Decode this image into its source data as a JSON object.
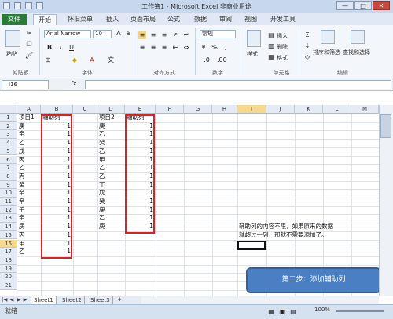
{
  "window": {
    "title": "工作簿1 - Microsoft Excel 非商业用途",
    "controls": [
      "—",
      "□",
      "✕"
    ]
  },
  "ribbon": {
    "tabs": [
      "文件",
      "开始",
      "插入",
      "页面布局",
      "公式",
      "数据",
      "审阅",
      "视图",
      "开发工具"
    ],
    "font_name": "Arial Narrow",
    "font_size": "10",
    "number_format": "常规",
    "paste_label": "粘贴",
    "style_label": "样式",
    "insert_label": "插入",
    "delete_label": "删除",
    "format_label": "格式",
    "sort_label": "排序和筛选",
    "find_label": "查找和选择",
    "groups": [
      "剪贴板",
      "字体",
      "对齐方式",
      "数字",
      "单元格",
      "编辑"
    ]
  },
  "formula_bar": {
    "name_box": "I16",
    "fx": "fx",
    "value": ""
  },
  "grid": {
    "columns": [
      "A",
      "B",
      "C",
      "D",
      "E",
      "F",
      "G",
      "H",
      "I",
      "J",
      "K",
      "L",
      "M"
    ],
    "rows": [
      "1",
      "2",
      "3",
      "4",
      "5",
      "6",
      "7",
      "8",
      "9",
      "10",
      "11",
      "12",
      "13",
      "14",
      "15",
      "16",
      "17",
      "18",
      "19",
      "20",
      "21",
      "22",
      "23"
    ],
    "colA": [
      "项目1",
      "庚",
      "辛",
      "乙",
      "戊",
      "丙",
      "乙",
      "丙",
      "癸",
      "辛",
      "辛",
      "壬",
      "辛",
      "庚",
      "丙",
      "甲",
      "乙"
    ],
    "colB": [
      "辅助列",
      "1",
      "1",
      "1",
      "1",
      "1",
      "1",
      "1",
      "1",
      "1",
      "1",
      "1",
      "1",
      "1",
      "1",
      "1",
      "1"
    ],
    "colD": [
      "项目2",
      "庚",
      "乙",
      "癸",
      "乙",
      "甲",
      "乙",
      "乙",
      "丁",
      "戊",
      "癸",
      "庚",
      "乙",
      "庚"
    ],
    "colE": [
      "辅助列",
      "1",
      "1",
      "1",
      "1",
      "1",
      "1",
      "1",
      "1",
      "1",
      "1",
      "1",
      "1",
      "1"
    ],
    "note_line1": "辅助列的内容不限，如果原来的数据",
    "note_line2": "就超过一列，那就不需要添加了。"
  },
  "callout": "第二步：添加辅助列",
  "sheets": [
    "Sheet1",
    "Sheet2",
    "Sheet3"
  ],
  "status": {
    "ready": "就绪",
    "zoom": "100%"
  }
}
